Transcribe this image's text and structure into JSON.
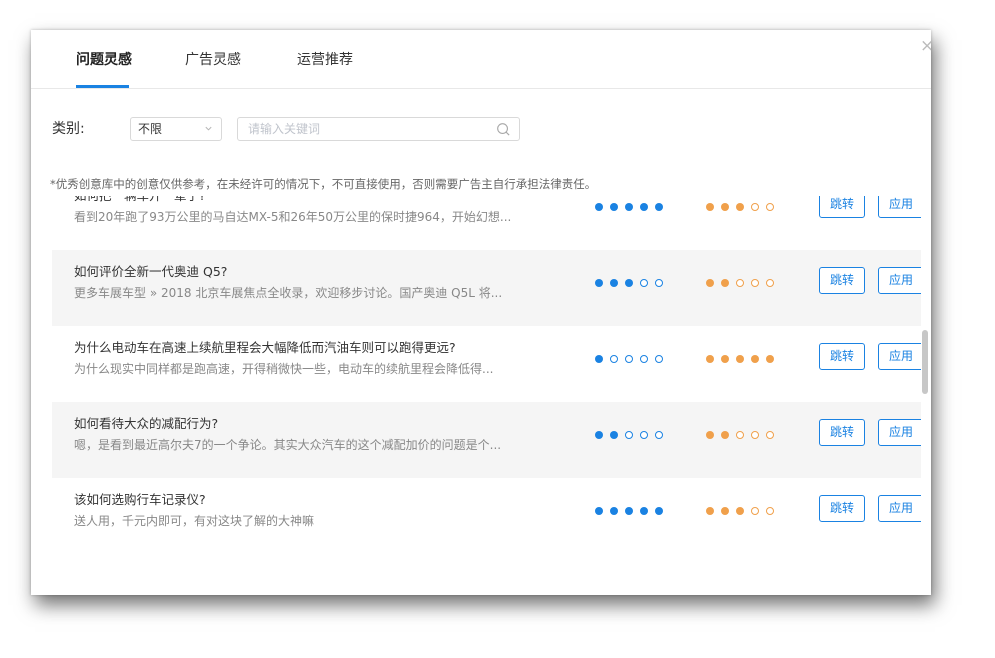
{
  "tabs": [
    {
      "label": "问题灵感",
      "active": true
    },
    {
      "label": "广告灵感",
      "active": false
    },
    {
      "label": "运营推荐",
      "active": false
    }
  ],
  "filter": {
    "category_label": "类别:",
    "category_value": "不限",
    "search_placeholder": "请输入关键词"
  },
  "notice": "*优秀创意库中的创意仅供参考，在未经许可的情况下，不可直接使用，否则需要广告主自行承担法律责任。",
  "buttons": {
    "jump": "跳转",
    "apply": "应用"
  },
  "colors": {
    "accent": "#1a82e2",
    "blue_dot": "#1a82e2",
    "orange_dot": "#f0a04b"
  },
  "items": [
    {
      "title": "如何把一辆车开一辈子?",
      "desc": "看到20年跑了93万公里的马自达MX-5和26年50万公里的保时捷964，开始幻想...",
      "blue_rating": 5,
      "orange_rating": 3
    },
    {
      "title": "如何评价全新一代奥迪 Q5?",
      "desc": "更多车展车型 » 2018 北京车展焦点全收录，欢迎移步讨论。国产奥迪 Q5L 将...",
      "blue_rating": 3,
      "orange_rating": 2
    },
    {
      "title": "为什么电动车在高速上续航里程会大幅降低而汽油车则可以跑得更远?",
      "desc": "为什么现实中同样都是跑高速，开得稍微快一些，电动车的续航里程会降低得...",
      "blue_rating": 1,
      "orange_rating": 5
    },
    {
      "title": "如何看待大众的减配行为?",
      "desc": "嗯，是看到最近高尔夫7的一个争论。其实大众汽车的这个减配加价的问题是个...",
      "blue_rating": 2,
      "orange_rating": 2
    },
    {
      "title": "该如何选购行车记录仪?",
      "desc": "送人用，千元内即可，有对这块了解的大神嘛",
      "blue_rating": 5,
      "orange_rating": 3
    }
  ]
}
